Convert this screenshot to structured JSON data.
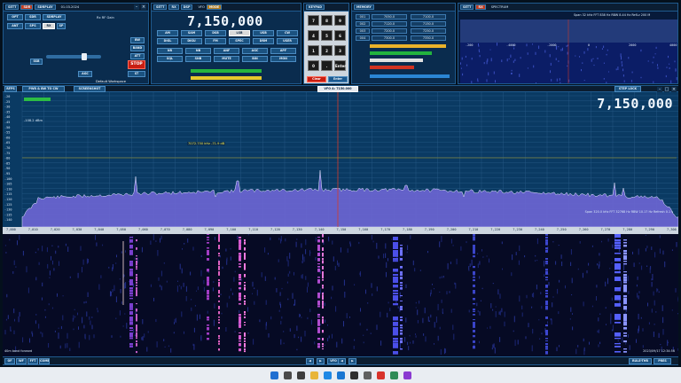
{
  "radio_panel": {
    "buttons_top": [
      "OPT",
      "SDR",
      "SDRPLAY",
      "ANT",
      "SPS",
      "RX",
      "SP"
    ],
    "rf_gain_label": "Rx RF Gain",
    "stop_label": "STOP",
    "workspace_label": "Default Workspace",
    "start_label": "ST",
    "date": "01.03.2024"
  },
  "vfo_panel": {
    "title": "VFO",
    "frequency": "7,150,000",
    "mode_buttons": [
      "AM",
      "SAM",
      "DSB",
      "LSB",
      "USB",
      "CW",
      "DIGL",
      "DIGU",
      "FM",
      "SPEC",
      "DRM",
      "USER"
    ],
    "misc_buttons": [
      "NR",
      "NB",
      "ANF",
      "AGC",
      "APF",
      "SQL",
      "SNB",
      "MUTE",
      "BIN",
      "MON"
    ]
  },
  "keypad": {
    "title": "KEYPAD",
    "keys": [
      "7",
      "8",
      "9",
      "4",
      "5",
      "6",
      "1",
      "2",
      "3",
      "0",
      ".",
      "Enter"
    ],
    "clear_label": "Clear",
    "enter_label": "Enter"
  },
  "memory_panel": {
    "title": "MEMORY",
    "rows": [
      {
        "a": "001",
        "b": "7050.0",
        "c": "7100.0"
      },
      {
        "a": "002",
        "b": "7120.0",
        "c": "7150.0"
      },
      {
        "a": "003",
        "b": "7200.0",
        "c": "7250.0"
      },
      {
        "a": "004",
        "b": "7300.0",
        "c": "7350.0"
      }
    ]
  },
  "spectrum_mini": {
    "title": "SPECTRUM",
    "info": "Span 32 kHz  FFT 838 Hz  RBW 8.44 Hz  RefLv 200 M",
    "ticks": [
      "-200",
      "-4000",
      "-2000",
      "0",
      "2000",
      "4000"
    ]
  },
  "main_toolbar": {
    "items": [
      "RFPS",
      "PWR & BW TO CW",
      "SCREENSHOT"
    ],
    "right": "STEP LOCK",
    "vfo_tag": "VFO A: 7150.000"
  },
  "main_spectrum": {
    "frequency": "7,150,000",
    "marker_text": "7072.750 kHz  -71.9 dB",
    "level_text": "-108.2 dBm",
    "footer_info": "Span 320.0 kHz  FFT 32768 Hz  RBW 10.17 Hz  Refresh 0.1 s",
    "db_ticks": [
      "-20",
      "-25",
      "-30",
      "-35",
      "-40",
      "-45",
      "-50",
      "-55",
      "-60",
      "-65",
      "-70",
      "-75",
      "-80",
      "-85",
      "-90",
      "-95",
      "-100",
      "-105",
      "-110",
      "-115",
      "-120",
      "-125",
      "-130",
      "-135",
      "-140"
    ],
    "freq_ticks": [
      "7,000",
      "7,010",
      "7,020",
      "7,030",
      "7,040",
      "7,050",
      "7,060",
      "7,070",
      "7,080",
      "7,090",
      "7,100",
      "7,110",
      "7,120",
      "7,130",
      "7,140",
      "7,150",
      "7,160",
      "7,170",
      "7,180",
      "7,190",
      "7,200",
      "7,210",
      "7,220",
      "7,230",
      "7,240",
      "7,250",
      "7,260",
      "7,270",
      "7,280",
      "7,290",
      "7,300"
    ]
  },
  "waterfall": {
    "bottom_left": "40m band forward",
    "timestamp": "2023/09/17 12:34:56"
  },
  "bottom_toolbar": {
    "left": [
      "OF",
      "WF",
      "FFT",
      "COMBO"
    ],
    "center": [
      "◀",
      "▶",
      "VFO",
      "◀",
      "▶"
    ],
    "right": [
      "RULE-THR",
      "PRES"
    ]
  },
  "taskbar": {
    "icons": [
      "windows-start-icon",
      "search-icon",
      "task-view-icon",
      "folder-icon",
      "browser-icon",
      "mail-icon",
      "store-icon",
      "settings-icon",
      "app1-icon",
      "app2-icon",
      "app3-icon"
    ]
  },
  "colors": {
    "panel_bg": "#0a2c4e",
    "spectrum_fill": "#6f68d6",
    "waterfall_bg": "#060a24",
    "accent_red": "#c81e12"
  }
}
